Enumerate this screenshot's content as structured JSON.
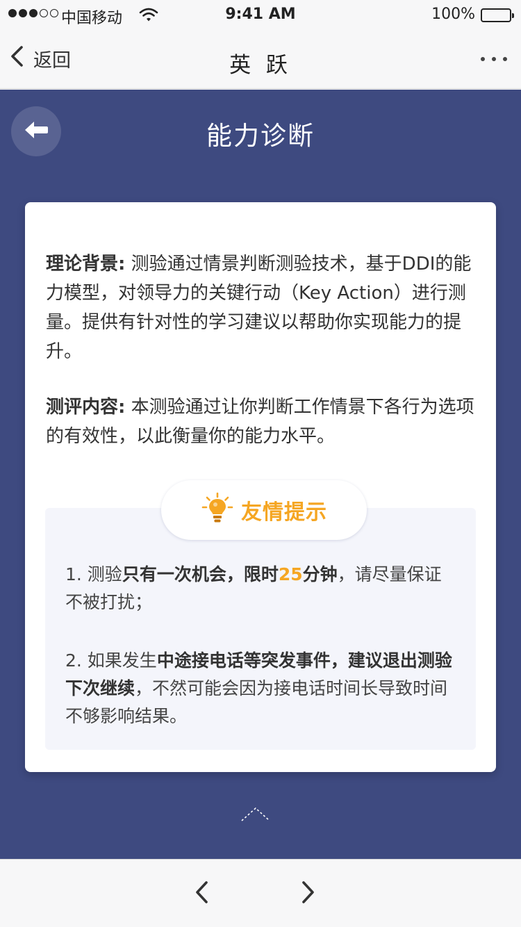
{
  "status_bar": {
    "carrier": "中国移动",
    "time": "9:41 AM",
    "battery": "100%"
  },
  "nav": {
    "back_label": "返回",
    "title": "英 跃"
  },
  "page": {
    "title": "能力诊断"
  },
  "card": {
    "theory_label": "理论背景:",
    "theory_text": " 测验通过情景判断测验技术，基于DDI的能力模型，对领导力的关键行动（Key Action）进行测量。提供有针对性的学习建议以帮助你实现能力的提升。",
    "content_label": "测评内容:",
    "content_text": " 本测验通过让你判断工作情景下各行为选项的有效性，以此衡量你的能力水平。"
  },
  "tips": {
    "title": "友情提示",
    "tip1_prefix": "1. 测验",
    "tip1_bold_a": "只有一次机会，限时",
    "tip1_highlight": "25",
    "tip1_bold_b": "分钟",
    "tip1_suffix": "，请尽量保证不被打扰；",
    "tip2_prefix": "2. 如果发生",
    "tip2_bold": "中途接电话等突发事件，建议退出测验下次继续",
    "tip2_suffix": "，不然可能会因为接电话时间长导致时间不够影响结果。"
  },
  "colors": {
    "main_bg": "#3e4a80",
    "accent": "#f5a623",
    "tips_bg": "#f4f5fb"
  },
  "icons": [
    "wifi-icon",
    "chevron-left-icon",
    "more-icon",
    "arrow-left-icon",
    "lightbulb-icon",
    "chevron-up-icon",
    "chevron-right-icon"
  ]
}
